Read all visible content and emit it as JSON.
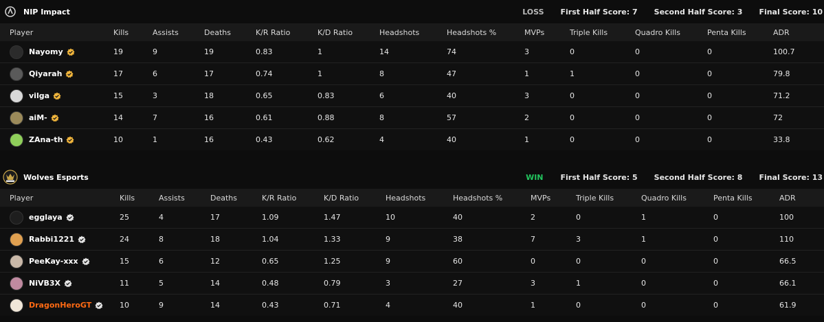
{
  "columns": [
    "Player",
    "Kills",
    "Assists",
    "Deaths",
    "K/R Ratio",
    "K/D Ratio",
    "Headshots",
    "Headshots %",
    "MVPs",
    "Triple Kills",
    "Quadro Kills",
    "Penta Kills",
    "ADR"
  ],
  "teams": [
    {
      "name": "NIP Impact",
      "result": "LOSS",
      "first_half": "First Half Score: 7",
      "second_half": "Second Half Score: 3",
      "final": "Final Score: 10",
      "players": [
        {
          "name": "Nayomy",
          "cells": [
            "19",
            "9",
            "19",
            "0.83",
            "1",
            "14",
            "74",
            "3",
            "0",
            "0",
            "0",
            "100.7"
          ],
          "avatar": "#2b2b2b",
          "badge": "gold"
        },
        {
          "name": "Qiyarah",
          "cells": [
            "17",
            "6",
            "17",
            "0.74",
            "1",
            "8",
            "47",
            "1",
            "1",
            "0",
            "0",
            "79.8"
          ],
          "avatar": "#5a5a5a",
          "badge": "gold"
        },
        {
          "name": "vilga",
          "cells": [
            "15",
            "3",
            "18",
            "0.65",
            "0.83",
            "6",
            "40",
            "3",
            "0",
            "0",
            "0",
            "71.2"
          ],
          "avatar": "#d9d9d9",
          "badge": "gold"
        },
        {
          "name": "aiM-",
          "cells": [
            "14",
            "7",
            "16",
            "0.61",
            "0.88",
            "8",
            "57",
            "2",
            "0",
            "0",
            "0",
            "72"
          ],
          "avatar": "#9b8a5a",
          "badge": "gold"
        },
        {
          "name": "ZAna-th",
          "cells": [
            "10",
            "1",
            "16",
            "0.43",
            "0.62",
            "4",
            "40",
            "1",
            "0",
            "0",
            "0",
            "33.8"
          ],
          "avatar": "#8fcf5a",
          "badge": "gold"
        }
      ]
    },
    {
      "name": "Wolves Esports",
      "result": "WIN",
      "first_half": "First Half Score: 5",
      "second_half": "Second Half Score: 8",
      "final": "Final Score: 13",
      "players": [
        {
          "name": "egglaya",
          "cells": [
            "25",
            "4",
            "17",
            "1.09",
            "1.47",
            "10",
            "40",
            "2",
            "0",
            "1",
            "0",
            "100"
          ],
          "avatar": "#1e1e1e",
          "badge": "verified"
        },
        {
          "name": "Rabbi1221",
          "cells": [
            "24",
            "8",
            "18",
            "1.04",
            "1.33",
            "9",
            "38",
            "7",
            "3",
            "1",
            "0",
            "110"
          ],
          "avatar": "#e0a050",
          "badge": "verified"
        },
        {
          "name": "PeeKay-xxx",
          "cells": [
            "15",
            "6",
            "12",
            "0.65",
            "1.25",
            "9",
            "60",
            "0",
            "0",
            "0",
            "0",
            "66.5"
          ],
          "avatar": "#c9b8a8",
          "badge": "verified"
        },
        {
          "name": "NiVB3X",
          "cells": [
            "11",
            "5",
            "14",
            "0.48",
            "0.79",
            "3",
            "27",
            "3",
            "1",
            "0",
            "0",
            "66.1"
          ],
          "avatar": "#c08aa0",
          "badge": "verified"
        },
        {
          "name": "DragonHeroGT",
          "cells": [
            "10",
            "9",
            "14",
            "0.43",
            "0.71",
            "4",
            "40",
            "1",
            "0",
            "0",
            "0",
            "61.9"
          ],
          "avatar": "#f0e6d8",
          "badge": "verified",
          "highlight": true
        }
      ]
    }
  ],
  "colors": {
    "background": "#0d0d0d",
    "header_row": "#1a1a1a",
    "win": "#22c55e",
    "loss": "#b8b8b8",
    "gold_badge": "#f2b63c",
    "highlight_name": "#ff6a13"
  },
  "icons": {
    "team1_logo": "nip-logo-icon",
    "team2_logo": "wolves-logo-icon",
    "gold_badge": "gold-badge-icon",
    "verified": "verified-check-icon"
  }
}
